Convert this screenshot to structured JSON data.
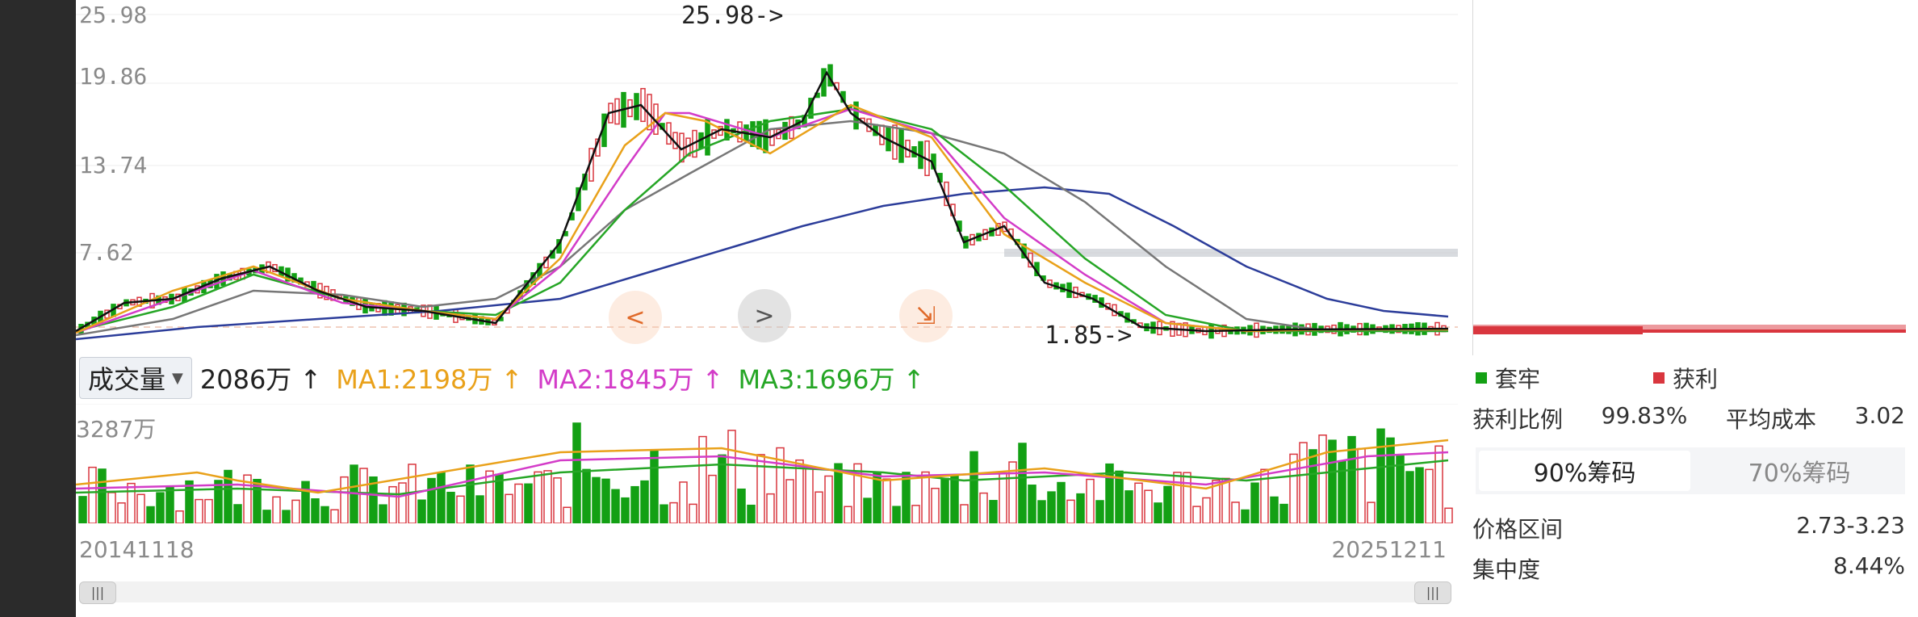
{
  "price_axis": {
    "labels": [
      "25.98",
      "19.86",
      "13.74",
      "7.62"
    ]
  },
  "max_marker": "25.98->",
  "min_marker": "1.85->",
  "indicators": {
    "volume_selector": "成交量",
    "vol_value": "2086万",
    "ma1": "MA1:2198万",
    "ma2": "MA2:1845万",
    "ma3": "MA3:1696万",
    "arrow": "↑"
  },
  "volume_axis": {
    "max": "3287万"
  },
  "dates": {
    "start": "20141118",
    "end": "20251211"
  },
  "chips": {
    "legend_trapped": "套牢",
    "legend_profit": "获利",
    "profit_ratio_label": "获利比例",
    "profit_ratio_value": "99.83%",
    "avg_cost_label": "平均成本",
    "avg_cost_value": "3.02",
    "tab_90": "90%筹码",
    "tab_70": "70%筹码",
    "price_range_label": "价格区间",
    "price_range_value": "2.73-3.23",
    "concentration_label": "集中度",
    "concentration_value": "8.44%"
  },
  "overlay_icons": [
    "left-arrow-icon",
    "next-arrow-icon",
    "collapse-icon"
  ],
  "colors": {
    "up": "#d9363e",
    "down": "#13a014",
    "ma_black": "#111111",
    "ma_orange": "#e9a11a",
    "ma_magenta": "#d33cc8",
    "ma_green": "#26a626",
    "ma_grey": "#777777",
    "ma_blue": "#2c3d9a"
  }
}
